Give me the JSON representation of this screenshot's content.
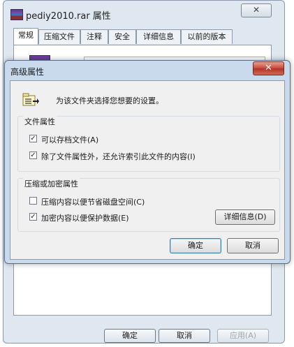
{
  "back_window": {
    "title": "pediy2010.rar 属性",
    "close_glyph": "✕",
    "tabs": [
      "常规",
      "压缩文件",
      "注释",
      "安全",
      "详细信息",
      "以前的版本"
    ],
    "buttons": {
      "ok": "确定",
      "cancel": "取消",
      "apply": "应用(A)"
    }
  },
  "dialog": {
    "title": "高级属性",
    "close_glyph": "✕",
    "header_text": "为该文件夹选择您想要的设置。",
    "file_attributes": {
      "label": "文件属性",
      "items": [
        {
          "label": "可以存档文件(A)",
          "checked": true
        },
        {
          "label": "除了文件属性外，还允许索引此文件的内容(I)",
          "checked": true
        }
      ]
    },
    "compress_encrypt": {
      "label": "压缩或加密属性",
      "items": [
        {
          "label": "压缩内容以便节省磁盘空间(C)",
          "checked": false
        },
        {
          "label": "加密内容以便保护数据(E)",
          "checked": true
        }
      ],
      "details_button": "详细信息(D)"
    },
    "buttons": {
      "ok": "确定",
      "cancel": "取消"
    }
  },
  "colors": {
    "dialog_frame": "#c9daed",
    "close_button": "#c8473a",
    "default_button_border": "#3c7fb1"
  }
}
